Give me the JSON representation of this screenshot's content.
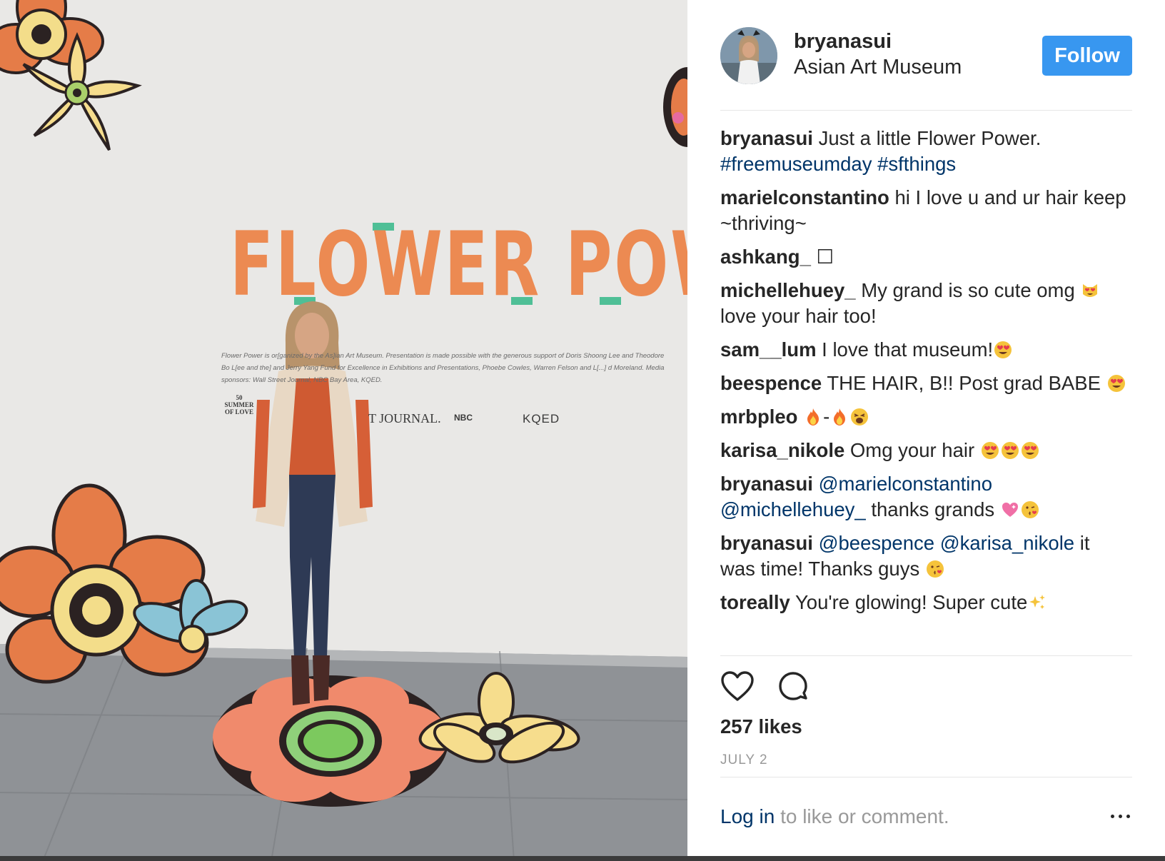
{
  "post": {
    "username": "bryanasui",
    "location": "Asian Art Museum",
    "follow_label": "Follow",
    "likes": "257 likes",
    "date": "JULY 2",
    "login_link": "Log in",
    "login_rest": "to like or comment."
  },
  "photo": {
    "wall_title": "FLOWER POWER",
    "wall_credit": "Flower Power is or[ganized by the As]ian Art Museum. Presentation is made possible with the generous support of Doris Shoong Lee and Theodore Bo L[ee and the] and Jerry Yang Fund for Excellence in Exhibitions and Presentations, Phoebe Cowles, Warren Felson and L[...] d Moreland. Media sponsors: Wall Street Journal, NBC Bay Area, KQED.",
    "sponsor_summer": "50 SUMMER OF LOVE",
    "sponsor_journal": "T JOURNAL.",
    "sponsor_nbc": "NBC",
    "sponsor_kqed": "KQED"
  },
  "comments": [
    {
      "user": "bryanasui",
      "parts": [
        {
          "t": "text",
          "v": "Just a little Flower Power. "
        },
        {
          "t": "link",
          "v": "#freemuseumday"
        },
        {
          "t": "text",
          "v": " "
        },
        {
          "t": "link",
          "v": "#sfthings"
        }
      ]
    },
    {
      "user": "marielconstantino",
      "parts": [
        {
          "t": "text",
          "v": "hi I love u and ur hair keep ~thriving~"
        }
      ]
    },
    {
      "user": "ashkang_",
      "parts": [
        {
          "t": "text",
          "v": "☐"
        }
      ]
    },
    {
      "user": "michellehuey_",
      "parts": [
        {
          "t": "text",
          "v": "My grand is so cute omg "
        },
        {
          "t": "emoji",
          "v": "heart-eyes-cat"
        },
        {
          "t": "text",
          "v": " love your hair too!"
        }
      ]
    },
    {
      "user": "sam__lum",
      "parts": [
        {
          "t": "text",
          "v": "I love that museum!"
        },
        {
          "t": "emoji",
          "v": "heart-eyes"
        }
      ]
    },
    {
      "user": "beespence",
      "parts": [
        {
          "t": "text",
          "v": "THE HAIR, B!! Post grad BABE "
        },
        {
          "t": "emoji",
          "v": "heart-eyes"
        }
      ]
    },
    {
      "user": "mrbpleo",
      "parts": [
        {
          "t": "emoji",
          "v": "fire"
        },
        {
          "t": "text",
          "v": "-"
        },
        {
          "t": "emoji",
          "v": "fire"
        },
        {
          "t": "emoji",
          "v": "weary"
        }
      ]
    },
    {
      "user": "karisa_nikole",
      "parts": [
        {
          "t": "text",
          "v": "Omg your hair "
        },
        {
          "t": "emoji",
          "v": "heart-eyes"
        },
        {
          "t": "emoji",
          "v": "heart-eyes"
        },
        {
          "t": "emoji",
          "v": "heart-eyes"
        }
      ]
    },
    {
      "user": "bryanasui",
      "parts": [
        {
          "t": "link",
          "v": "@marielconstantino"
        },
        {
          "t": "text",
          "v": " "
        },
        {
          "t": "link",
          "v": "@michellehuey_"
        },
        {
          "t": "text",
          "v": " thanks grands "
        },
        {
          "t": "emoji",
          "v": "sparkling-heart"
        },
        {
          "t": "emoji",
          "v": "kiss"
        }
      ]
    },
    {
      "user": "bryanasui",
      "parts": [
        {
          "t": "link",
          "v": "@beespence"
        },
        {
          "t": "text",
          "v": " "
        },
        {
          "t": "link",
          "v": "@karisa_nikole"
        },
        {
          "t": "text",
          "v": " it was time! Thanks guys "
        },
        {
          "t": "emoji",
          "v": "kiss"
        }
      ]
    },
    {
      "user": "toreally",
      "parts": [
        {
          "t": "text",
          "v": "You're glowing! Super cute"
        },
        {
          "t": "emoji",
          "v": "sparkles"
        }
      ]
    }
  ],
  "icons": {
    "like": "heart-outline-icon",
    "comment": "comment-bubble-icon",
    "more": "more-dots-icon"
  },
  "colors": {
    "follow_bg": "#3897f0",
    "link": "#003569",
    "muted": "#999999",
    "wall_orange": "#ec8a52",
    "wall_green": "#4fbf96"
  }
}
